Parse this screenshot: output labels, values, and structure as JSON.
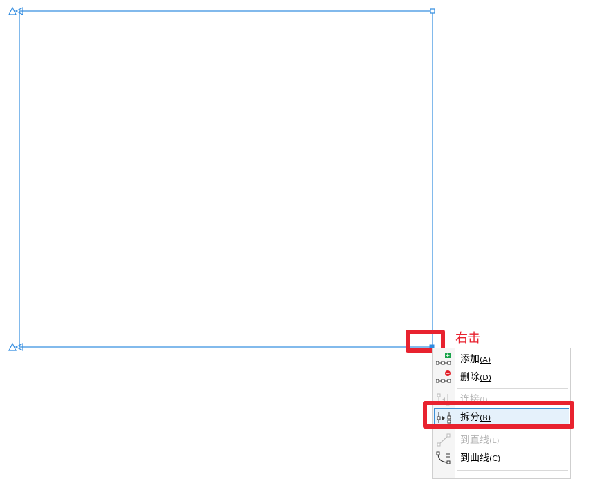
{
  "annotation": {
    "label": "右击",
    "color": "#e8222f"
  },
  "colors": {
    "path_stroke": "#2f8be0",
    "highlight_border": "#e8222f",
    "menu_hover_fill": "#e5f1fb"
  },
  "context_menu": {
    "items": [
      {
        "label": "添加",
        "key": "(A)",
        "icon": "add-node-icon",
        "enabled": true
      },
      {
        "label": "删除",
        "key": "(D)",
        "icon": "delete-node-icon",
        "enabled": true
      },
      {
        "label": "连接",
        "key": "(J)",
        "icon": "join-nodes-icon",
        "enabled": false
      },
      {
        "label": "拆分",
        "key": "(B)",
        "icon": "break-apart-icon",
        "enabled": true,
        "highlighted": true
      },
      {
        "label": "到直线",
        "key": "(L)",
        "icon": "to-line-icon",
        "enabled": false
      },
      {
        "label": "到曲线",
        "key": "(C)",
        "icon": "to-curve-icon",
        "enabled": true
      }
    ]
  }
}
